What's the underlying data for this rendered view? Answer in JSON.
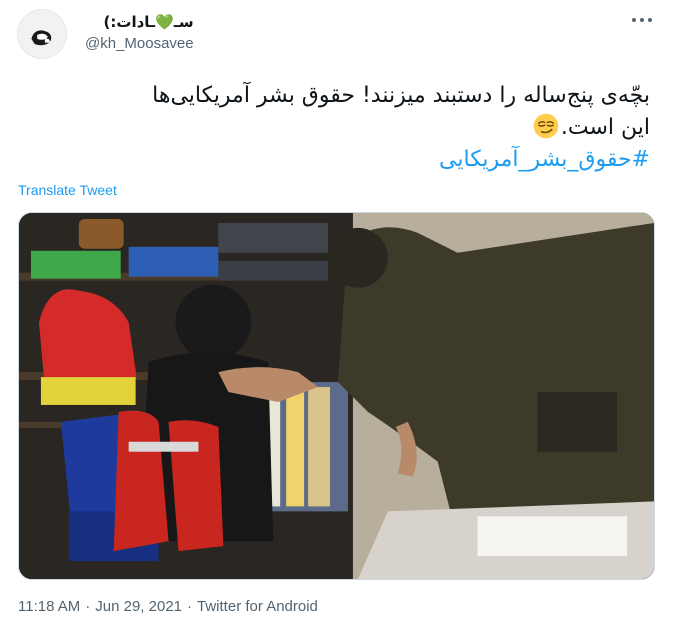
{
  "user": {
    "display_name": "سـ💚ـادات:)",
    "handle": "@kh_Moosavee",
    "avatar_icon": "avatar-image"
  },
  "menu": {
    "icon": "more-dots-icon"
  },
  "tweet": {
    "line1": "بچّه‌ی پنج‌ساله را دستبند میزنند! حقوق بشر آمریکایی‌ها",
    "line2": "این است.",
    "emoji": "smirking-face-emoji",
    "hashtag": "#حقوق_بشر_آمریکایی"
  },
  "translate_label": "Translate Tweet",
  "media": {
    "description_icon": "photo-image"
  },
  "meta": {
    "time": "11:18 AM",
    "separator1": "·",
    "date": "Jun 29, 2021",
    "separator2": "·",
    "source": "Twitter for Android"
  },
  "colors": {
    "link": "#1d9bf0",
    "secondary_text": "#536471",
    "primary_text": "#0f1419"
  }
}
